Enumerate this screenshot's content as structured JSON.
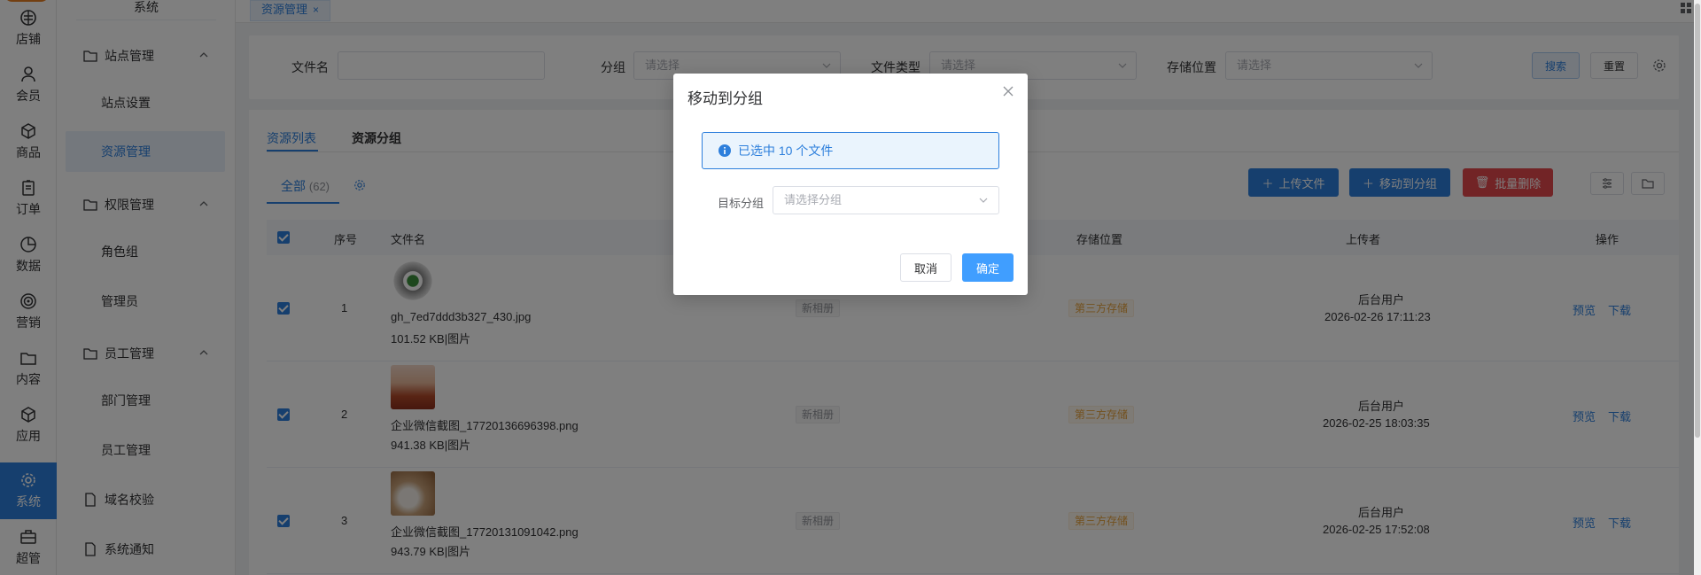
{
  "rail": {
    "items": [
      {
        "label": "店铺",
        "icon": "store-icon"
      },
      {
        "label": "会员",
        "icon": "member-icon"
      },
      {
        "label": "商品",
        "icon": "product-icon"
      },
      {
        "label": "订单",
        "icon": "order-icon"
      },
      {
        "label": "数据",
        "icon": "chart-icon"
      },
      {
        "label": "营销",
        "icon": "marketing-icon"
      },
      {
        "label": "内容",
        "icon": "content-icon"
      },
      {
        "label": "应用",
        "icon": "app-icon"
      },
      {
        "label": "系统",
        "icon": "settings-icon",
        "active": true
      },
      {
        "label": "超管",
        "icon": "admin-icon"
      }
    ]
  },
  "submenu": {
    "title": "系统",
    "groups": {
      "site": "站点管理",
      "site_settings": "站点设置",
      "resource": "资源管理",
      "perm": "权限管理",
      "roles": "角色组",
      "admins": "管理员",
      "staff": "员工管理",
      "dept": "部门管理",
      "staff_mgmt": "员工管理",
      "domain": "域名校验",
      "notice": "系统通知"
    }
  },
  "tabbar": {
    "active_tab": "资源管理",
    "close": "×"
  },
  "filters": {
    "filename_label": "文件名",
    "filename_value": "",
    "group_label": "分组",
    "group_placeholder": "请选择",
    "type_label": "文件类型",
    "type_placeholder": "请选择",
    "storage_label": "存储位置",
    "storage_placeholder": "请选择",
    "search": "搜索",
    "reset": "重置"
  },
  "card": {
    "tab_list": "资源列表",
    "tab_group": "资源分组",
    "sub_all": "全部",
    "sub_count": "(62)",
    "upload": "上传文件",
    "move": "移动到分组",
    "batch_delete": "批量删除"
  },
  "table": {
    "headers": {
      "index": "序号",
      "filename": "文件名",
      "storage": "存储位置",
      "uploader": "上传者",
      "actions": "操作"
    },
    "rows": [
      {
        "index": "1",
        "name": "gh_7ed7ddd3b327_430.jpg",
        "meta": "101.52 KB|图片",
        "album": "新相册",
        "storage": "第三方存储",
        "uploader": "后台用户",
        "time": "2026-02-26 17:11:23",
        "preview": "预览",
        "download": "下载"
      },
      {
        "index": "2",
        "name": "企业微信截图_17720136696398.png",
        "meta": "941.38 KB|图片",
        "album": "新相册",
        "storage": "第三方存储",
        "uploader": "后台用户",
        "time": "2026-02-25 18:03:35",
        "preview": "预览",
        "download": "下载"
      },
      {
        "index": "3",
        "name": "企业微信截图_17720131091042.png",
        "meta": "943.79 KB|图片",
        "album": "新相册",
        "storage": "第三方存储",
        "uploader": "后台用户",
        "time": "2026-02-25 17:52:08",
        "preview": "预览",
        "download": "下载"
      }
    ]
  },
  "dialog": {
    "title": "移动到分组",
    "alert": "已选中 10 个文件",
    "target_label": "目标分组",
    "target_placeholder": "请选择分组",
    "cancel": "取消",
    "confirm": "确定"
  },
  "colors": {
    "accent": "#2d7fdc",
    "danger": "#e5484d",
    "warning": "#e6a23c"
  }
}
